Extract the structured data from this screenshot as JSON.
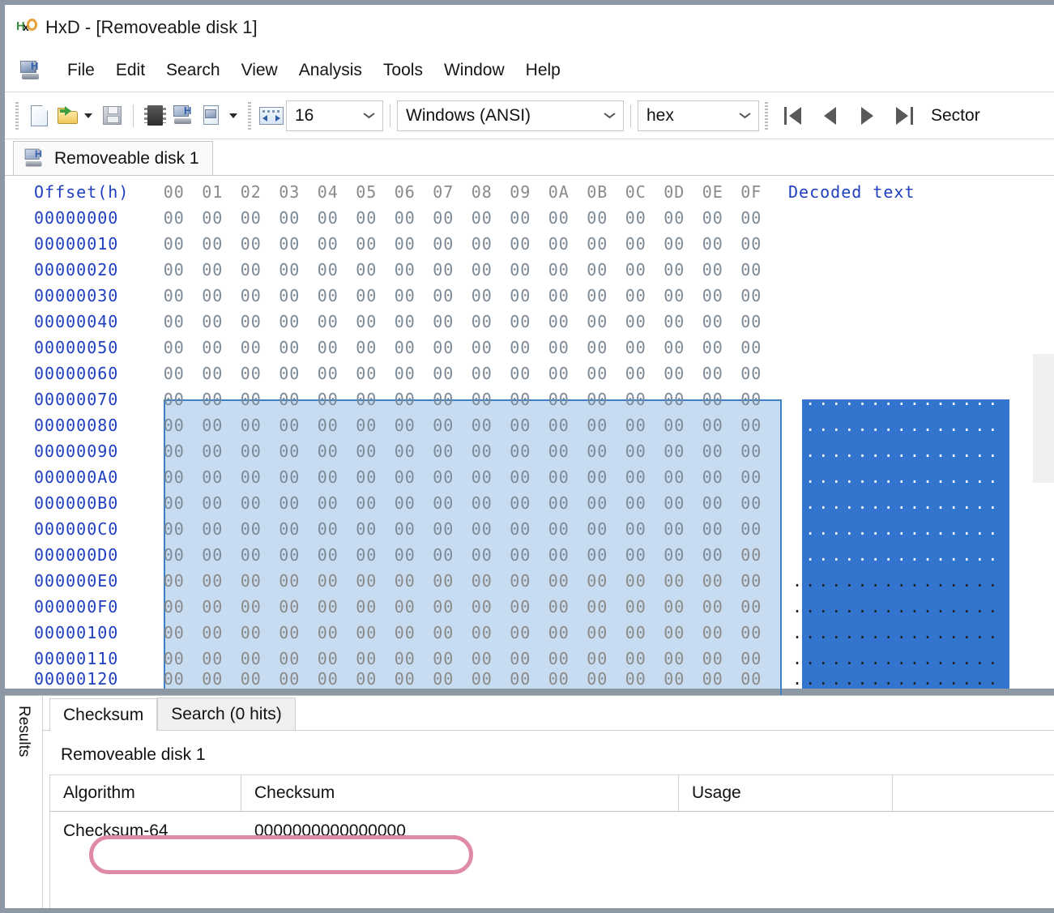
{
  "window": {
    "app_name": "HxD",
    "title": "HxD - [Removeable disk 1]",
    "logo_h": "H",
    "logo_x": "x",
    "menu_h": "H"
  },
  "menubar": {
    "items": [
      {
        "label": "File"
      },
      {
        "label": "Edit"
      },
      {
        "label": "Search"
      },
      {
        "label": "View"
      },
      {
        "label": "Analysis"
      },
      {
        "label": "Tools"
      },
      {
        "label": "Window"
      },
      {
        "label": "Help"
      }
    ]
  },
  "toolbar": {
    "bytes_per_row": "16",
    "encoding": "Windows (ANSI)",
    "offset_base": "hex",
    "sector_label": "Sector"
  },
  "document_tabs": [
    {
      "label": "Removeable disk 1",
      "active": true
    }
  ],
  "hex_view": {
    "header": {
      "offset_label": "Offset(h)",
      "columns": [
        "00",
        "01",
        "02",
        "03",
        "04",
        "05",
        "06",
        "07",
        "08",
        "09",
        "0A",
        "0B",
        "0C",
        "0D",
        "0E",
        "0F"
      ],
      "decoded_label": "Decoded text"
    },
    "byte_value": "00",
    "decoded_char": ".",
    "rows": [
      {
        "offset": "00000000",
        "selected": true
      },
      {
        "offset": "00000010",
        "selected": true
      },
      {
        "offset": "00000020",
        "selected": true
      },
      {
        "offset": "00000030",
        "selected": true
      },
      {
        "offset": "00000040",
        "selected": true
      },
      {
        "offset": "00000050",
        "selected": true
      },
      {
        "offset": "00000060",
        "selected": true
      },
      {
        "offset": "00000070",
        "selected": true
      },
      {
        "offset": "00000080",
        "selected": true
      },
      {
        "offset": "00000090",
        "selected": true
      },
      {
        "offset": "000000A0",
        "selected": true
      },
      {
        "offset": "000000B0",
        "selected": true
      },
      {
        "offset": "000000C0",
        "selected": true
      },
      {
        "offset": "000000D0",
        "selected": true,
        "partial": true,
        "selected_bytes": 15
      },
      {
        "offset": "000000E0",
        "selected": false
      },
      {
        "offset": "000000F0",
        "selected": false
      },
      {
        "offset": "00000100",
        "selected": false
      },
      {
        "offset": "00000110",
        "selected": false
      },
      {
        "offset": "00000120",
        "selected": false,
        "clipped": true
      }
    ],
    "colors": {
      "offset_text": "#1f3fbf",
      "header_text": "#1f3fbf",
      "byte_text": "#8a8a8a",
      "hex_selection_fill": "#c8dcf1",
      "hex_selection_border": "#3f7fc4",
      "text_selection_fill": "#3375ce"
    }
  },
  "results": {
    "rail_label": "Results",
    "tabs": [
      {
        "label": "Checksum",
        "active": true
      },
      {
        "label": "Search (0 hits)",
        "active": false
      }
    ],
    "source": "Removeable disk 1",
    "table": {
      "columns": [
        "Algorithm",
        "Checksum",
        "Usage"
      ],
      "rows": [
        {
          "algorithm": "Checksum-64",
          "checksum": "0000000000000000",
          "usage": "",
          "annotated": true
        }
      ]
    },
    "annotation_color": "#e08aa9"
  }
}
